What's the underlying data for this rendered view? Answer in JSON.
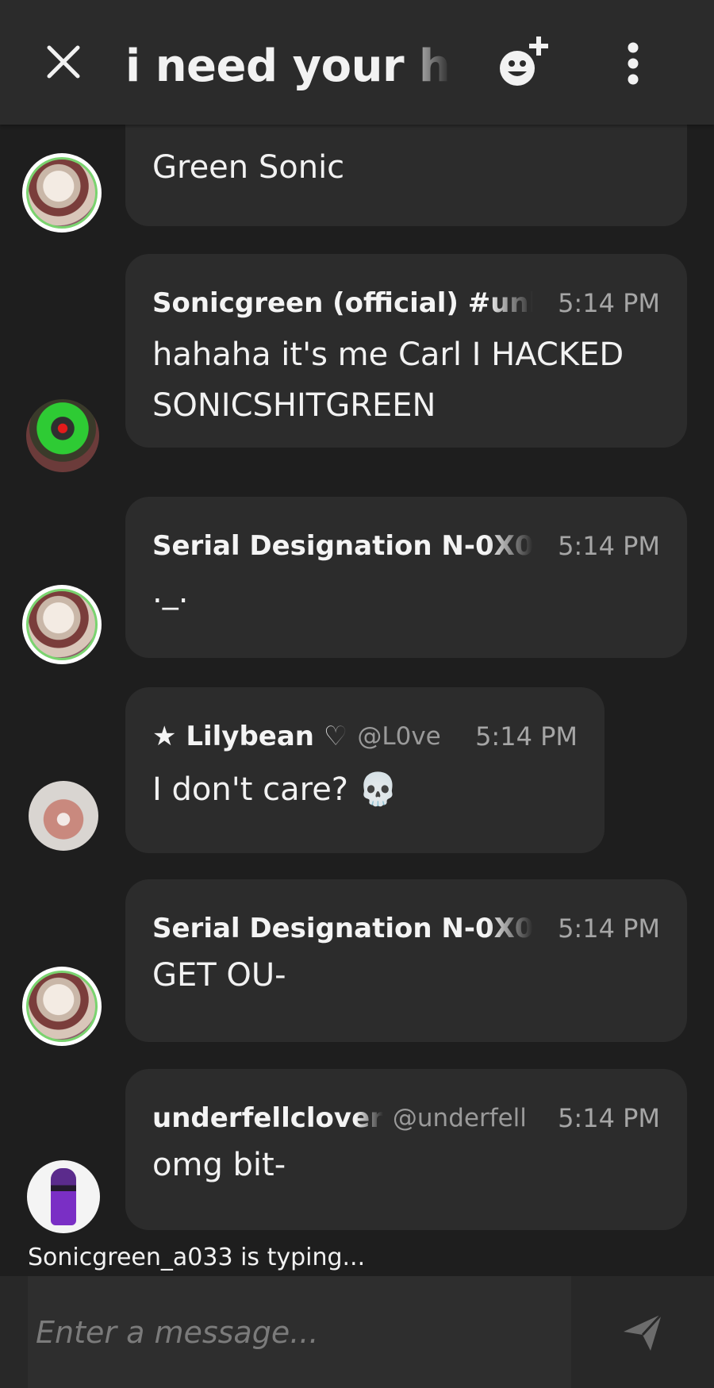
{
  "header": {
    "title": "i need your help",
    "icons": {
      "close": "close-icon",
      "invite": "add-emoji-icon",
      "more": "more-vertical-icon"
    }
  },
  "messages": [
    {
      "name": "",
      "handle": "",
      "time": "",
      "text": "Green Sonic",
      "avatar": "cookie-avatar"
    },
    {
      "name": "Sonicgreen (official) #unl",
      "handle": "",
      "time": "5:14 PM",
      "text": "hahaha it's me Carl I HACKED SONICSHITGREEN",
      "avatar": "green-sonic-avatar"
    },
    {
      "name": "Serial Designation N-0X0",
      "handle": "",
      "time": "5:14 PM",
      "text": "._.",
      "avatar": "cookie-avatar"
    },
    {
      "name": "★ Lilybean ♡",
      "handle": "@L0ve",
      "time": "5:14 PM",
      "text": "I don't care? 💀",
      "avatar": "heart-hands-avatar"
    },
    {
      "name": "Serial Designation N-0X0",
      "handle": "",
      "time": "5:14 PM",
      "text": "GET OU-",
      "avatar": "cookie-avatar"
    },
    {
      "name": "underfellclover",
      "handle": "@underfell",
      "time": "5:14 PM",
      "text": "omg bit-",
      "avatar": "purple-character-avatar"
    }
  ],
  "typing_indicator": "Sonicgreen_a033 is typing...",
  "composer": {
    "placeholder": "Enter a message...",
    "send_icon": "send-icon"
  },
  "colors": {
    "background": "#1e1e1e",
    "header": "#2b2b2b",
    "bubble": "#2c2c2c",
    "text": "#f2f2f2",
    "muted": "#a6a6a6"
  }
}
